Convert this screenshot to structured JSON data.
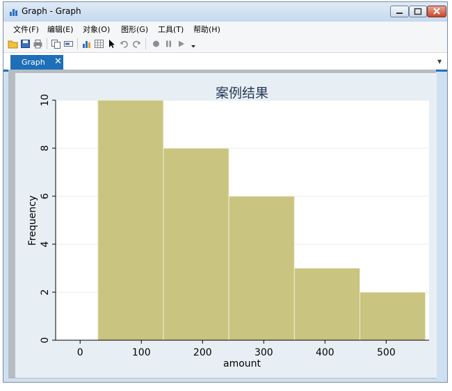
{
  "window": {
    "title": "Graph - Graph",
    "controls": {
      "minimize": "minimize-icon",
      "maximize": "maximize-icon",
      "close": "close-icon"
    }
  },
  "menu": [
    "文件(F)",
    "编辑(E)",
    "对象(O)",
    "图形(G)",
    "工具(T)",
    "帮助(H)"
  ],
  "toolbar": {
    "icons": [
      "open-folder-icon",
      "save-icon",
      "print-icon",
      "copy-icon",
      "rename-icon",
      "graph-editor-icon",
      "data-editor-icon",
      "pointer-icon",
      "undo-icon",
      "redo-icon",
      "record-icon",
      "pause-icon",
      "play-icon"
    ]
  },
  "tabs": [
    {
      "label": "Graph",
      "close": "✕"
    }
  ],
  "colors": {
    "bar_fill": "#c9c47f",
    "bar_stroke": "#f2efd8",
    "tab_active": "#1e6fb8",
    "plot_bg": "#ffffff",
    "grid": "#e3ebf0"
  },
  "chart_data": {
    "type": "histogram",
    "title": "案例结果",
    "xlabel": "amount",
    "ylabel": "Frequency",
    "xlim": [
      -40,
      570
    ],
    "ylim": [
      0,
      10
    ],
    "xticks": [
      0,
      100,
      200,
      300,
      400,
      500
    ],
    "yticks": [
      0,
      2,
      4,
      6,
      8,
      10
    ],
    "bins": [
      {
        "x0": 29,
        "x1": 136,
        "value": 10
      },
      {
        "x0": 136,
        "x1": 243,
        "value": 8
      },
      {
        "x0": 243,
        "x1": 350,
        "value": 6
      },
      {
        "x0": 350,
        "x1": 457,
        "value": 3
      },
      {
        "x0": 457,
        "x1": 564,
        "value": 2
      }
    ],
    "grid": true
  }
}
